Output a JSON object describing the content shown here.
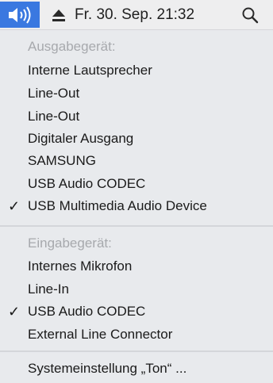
{
  "menubar": {
    "clock": "Fr. 30. Sep.  21:32"
  },
  "output": {
    "header": "Ausgabegerät:",
    "items": [
      {
        "label": "Interne Lautsprecher",
        "checked": false
      },
      {
        "label": "Line-Out",
        "checked": false
      },
      {
        "label": "Line-Out",
        "checked": false
      },
      {
        "label": "Digitaler Ausgang",
        "checked": false
      },
      {
        "label": "SAMSUNG",
        "checked": false
      },
      {
        "label": "USB Audio CODEC",
        "checked": false
      },
      {
        "label": "USB Multimedia Audio Device",
        "checked": true
      }
    ]
  },
  "input": {
    "header": "Eingabegerät:",
    "items": [
      {
        "label": "Internes Mikrofon",
        "checked": false
      },
      {
        "label": "Line-In",
        "checked": false
      },
      {
        "label": "USB Audio CODEC",
        "checked": true
      },
      {
        "label": "External Line Connector",
        "checked": false
      }
    ]
  },
  "footer": {
    "settings_label": "Systemeinstellung „Ton“ ..."
  },
  "checkmark_glyph": "✓",
  "colors": {
    "accent": "#3a78e0",
    "header_text": "#a7a9ad",
    "menu_bg": "#e8eaed"
  }
}
